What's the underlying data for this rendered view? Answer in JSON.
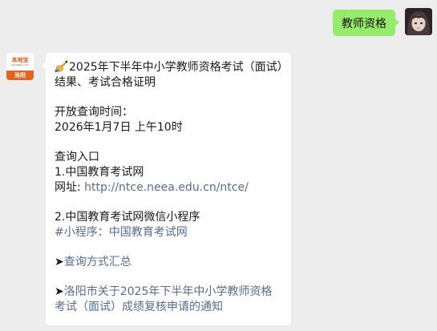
{
  "user_message": {
    "text": "教师资格"
  },
  "bot_avatar": {
    "brand": "本地宝",
    "brand_url": "bendibao.com",
    "city": "洛阳"
  },
  "bot_message": {
    "emoji_icon": "writing-hand-icon",
    "title": "2025年下半年中小学教师资格考试（面试）结果、考试合格证明",
    "open_time_label": "开放查询时间：",
    "open_time_value": "2026年1月7日 上午10时",
    "entry_label": "查询入口",
    "entry1_name": "1.中国教育考试网",
    "entry1_url_prefix": "网址: ",
    "entry1_url": "http://ntce.neea.edu.cn/ntce/",
    "entry2_name": "2.中国教育考试网微信小程序",
    "entry2_mini_program": "#小程序：中国教育考试网",
    "arrow_symbol": "➤",
    "link1": "查询方式汇总",
    "link2": "洛阳市关于2025年下半年中小学教师资格考试（面试）成绩复核申请的通知"
  },
  "colors": {
    "chat_background": "#ededed",
    "user_bubble": "#95ec69",
    "bot_bubble": "#ffffff",
    "link": "#576b95",
    "brand_orange": "#e8621e"
  }
}
